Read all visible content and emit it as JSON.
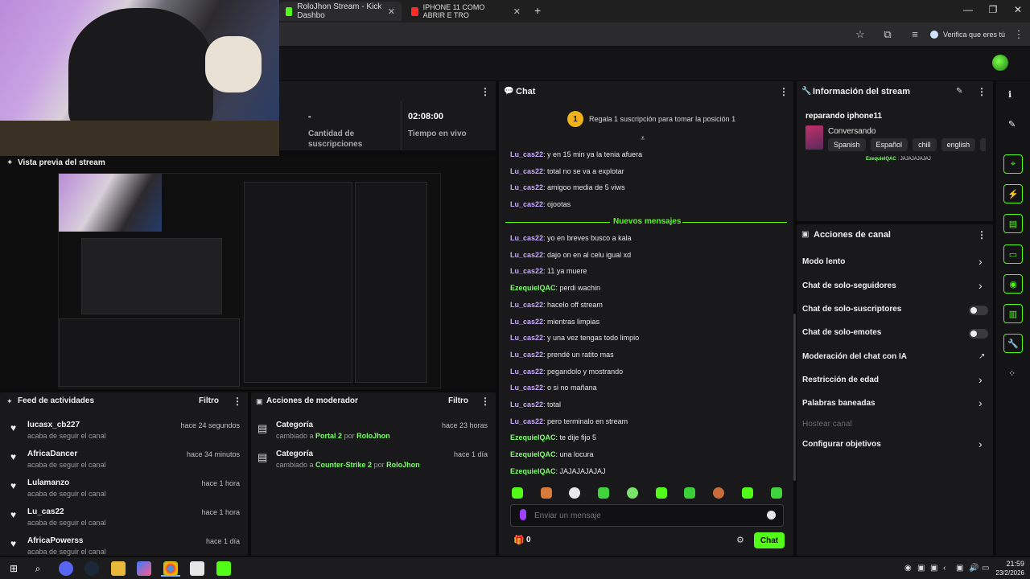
{
  "browser": {
    "tabs": [
      {
        "label": "RoloJhon Stream - Kick Dashbo",
        "favicon_color": "#53fc18"
      },
      {
        "label": "IPHONE 11 COMO ABRIR E TRO",
        "favicon_color": "#ff2a2a"
      }
    ],
    "new_tab": "+",
    "window": {
      "minimize": "—",
      "restore": "❐",
      "close": "✕"
    },
    "verify_label": "Verifica que eres tú"
  },
  "stats": {
    "subs_value": "-",
    "subs_label": "Cantidad de suscripciones",
    "live_value": "02:08:00",
    "live_label": "Tiempo en vivo"
  },
  "preview": {
    "title": "Vista previa del stream"
  },
  "feed": {
    "title": "Feed de actividades",
    "filter": "Filtro",
    "items": [
      {
        "name": "lucasx_cb227",
        "sub": "acaba de seguir el canal",
        "time": "hace 24 segundos"
      },
      {
        "name": "AfricaDancer",
        "sub": "acaba de seguir el canal",
        "time": "hace 34 minutos"
      },
      {
        "name": "Lulamanzo",
        "sub": "acaba de seguir el canal",
        "time": "hace 1 hora"
      },
      {
        "name": "Lu_cas22",
        "sub": "acaba de seguir el canal",
        "time": "hace 1 hora"
      },
      {
        "name": "AfricaPowerss",
        "sub": "acaba de seguir el canal",
        "time": "hace 1 día"
      }
    ]
  },
  "mod": {
    "title": "Acciones de moderador",
    "filter": "Filtro",
    "items": [
      {
        "title": "Categoría",
        "prefix": "cambiado a",
        "target": "Portal 2",
        "by": "por",
        "user": "RoloJhon",
        "time": "hace 23 horas"
      },
      {
        "title": "Categoría",
        "prefix": "cambiado a",
        "target": "Counter-Strike 2",
        "by": "por",
        "user": "RoloJhon",
        "time": "hace 1 día"
      }
    ]
  },
  "chat": {
    "title": "Chat",
    "promo_badge": "1",
    "promo": "Regala 1 suscripción para tomar la posición 1",
    "new_messages": "Nuevos mensajes",
    "messages_before": [
      {
        "user": "Lu_cas22",
        "text": "y en 15 min ya la tenia afuera"
      },
      {
        "user": "Lu_cas22",
        "text": "total no se va a explotar"
      },
      {
        "user": "Lu_cas22",
        "text": "amigoo media de 5 viws"
      },
      {
        "user": "Lu_cas22",
        "text": "ojootas"
      }
    ],
    "messages_after": [
      {
        "user": "Lu_cas22",
        "text": "yo en breves busco a kala",
        "kind": "u1"
      },
      {
        "user": "Lu_cas22",
        "text": "dajo on en al celu igual xd",
        "kind": "u1"
      },
      {
        "user": "Lu_cas22",
        "text": "11 ya muere",
        "kind": "u1"
      },
      {
        "user": "EzequielQAC",
        "text": "perdi wachin",
        "kind": "u2"
      },
      {
        "user": "Lu_cas22",
        "text": "hacelo off stream",
        "kind": "u1"
      },
      {
        "user": "Lu_cas22",
        "text": "mientras limpias",
        "kind": "u1"
      },
      {
        "user": "Lu_cas22",
        "text": "y una vez tengas todo limpio",
        "kind": "u1"
      },
      {
        "user": "Lu_cas22",
        "text": "prendé un ratito mas",
        "kind": "u1"
      },
      {
        "user": "Lu_cas22",
        "text": "pegandolo y mostrando",
        "kind": "u1"
      },
      {
        "user": "Lu_cas22",
        "text": "o si no mañana",
        "kind": "u1"
      },
      {
        "user": "Lu_cas22",
        "text": "total",
        "kind": "u1"
      },
      {
        "user": "Lu_cas22",
        "text": "pero terminalo en stream",
        "kind": "u1"
      },
      {
        "user": "EzequielQAC",
        "text": "te dije fijo 5",
        "kind": "u2"
      },
      {
        "user": "EzequielQAC",
        "text": "una locura",
        "kind": "u2"
      },
      {
        "user": "EzequielQAC",
        "text": "JAJAJAJAJAJ",
        "kind": "u2"
      }
    ],
    "input_placeholder": "Enviar un mensaje",
    "points": "0",
    "send_label": "Chat"
  },
  "info": {
    "title": "Información del stream",
    "stream_title": "reparando iphone11",
    "category": "Conversando",
    "tags": [
      "Spanish",
      "Español",
      "chill",
      "english",
      "fu"
    ],
    "last_user": "EzequielQAC",
    "last_msg": "JAJAJAJAJAJ"
  },
  "actions": {
    "title": "Acciones de canal",
    "items": [
      {
        "label": "Modo lento",
        "control": "chevron"
      },
      {
        "label": "Chat de solo-seguidores",
        "control": "chevron"
      },
      {
        "label": "Chat de solo-suscriptores",
        "control": "toggle"
      },
      {
        "label": "Chat de solo-emotes",
        "control": "toggle"
      },
      {
        "label": "Moderación del chat con IA",
        "control": "external"
      },
      {
        "label": "Restricción de edad",
        "control": "chevron"
      },
      {
        "label": "Palabras baneadas",
        "control": "chevron"
      },
      {
        "label": "Hostear canal",
        "control": "disabled"
      },
      {
        "label": "Configurar objetivos",
        "control": "chevron"
      }
    ]
  },
  "taskbar": {
    "time": "21:59",
    "date": "23/2/2026"
  },
  "colors": {
    "accent": "#53fc18",
    "user_purple": "#c7a6ff",
    "user_green": "#7dff6a",
    "panel": "#19191b"
  }
}
